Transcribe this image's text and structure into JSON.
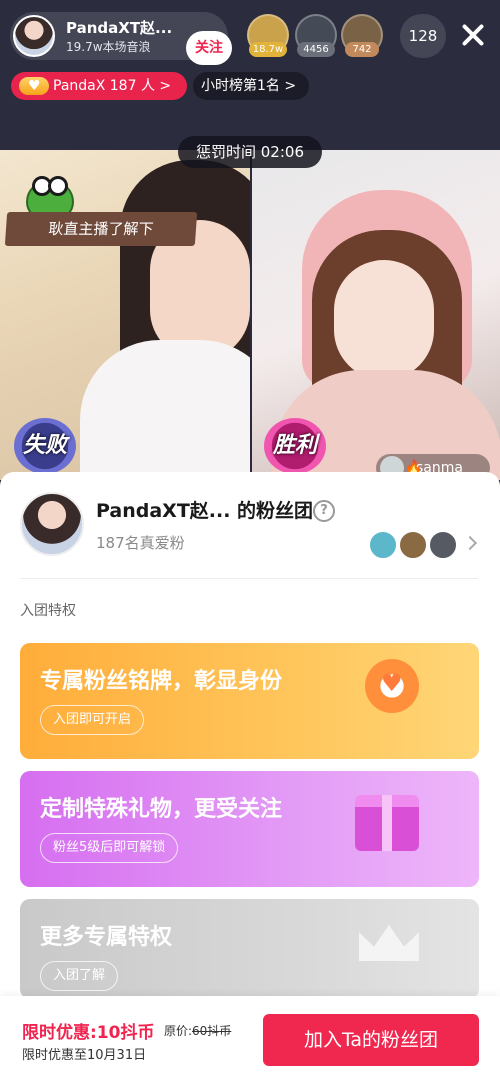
{
  "header": {
    "host_name": "PandaXT赵...",
    "host_sub": "19.7w本场音浪",
    "follow_label": "关注",
    "viewers": [
      {
        "badge": "18.7w",
        "color": "#c9a24b",
        "badge_color": "#e2b33a"
      },
      {
        "badge": "4456",
        "color": "#444a56",
        "badge_color": "#6b6f79"
      },
      {
        "badge": "742",
        "color": "#7a6246",
        "badge_color": "#c28a5a"
      }
    ],
    "viewer_count": "128",
    "fans_pill": "PandaX 187 人 >",
    "rank_pill": "小时榜第1名 >"
  },
  "pk": {
    "punish_timer": "惩罚时间   02:06",
    "sign_text": "耿直主播了解下",
    "lose_label": "失败",
    "win_label": "胜利",
    "right_user": "sanma"
  },
  "sheet": {
    "title": "PandaXT赵... 的粉丝团",
    "subtitle": "187名真爱粉",
    "section_label": "入团特权",
    "members": [
      "#5bb7c9",
      "#8a6a42",
      "#555a63"
    ],
    "cards": [
      {
        "title": "专属粉丝铭牌，彰显身份",
        "tag": "入团即可开启"
      },
      {
        "title": "定制特殊礼物，更受关注",
        "tag": "粉丝5级后即可解锁"
      },
      {
        "title": "更多专属特权",
        "tag": "入团了解"
      }
    ]
  },
  "bottom_bar": {
    "offer_price": "限时优惠:10抖币",
    "orig_label": "原价:",
    "orig_price": "60抖币",
    "deadline": "限时优惠至10月31日",
    "join_label": "加入Ta的粉丝团"
  },
  "colors": {
    "accent": "#f0244f",
    "header_bg": "#2b2c3e"
  }
}
